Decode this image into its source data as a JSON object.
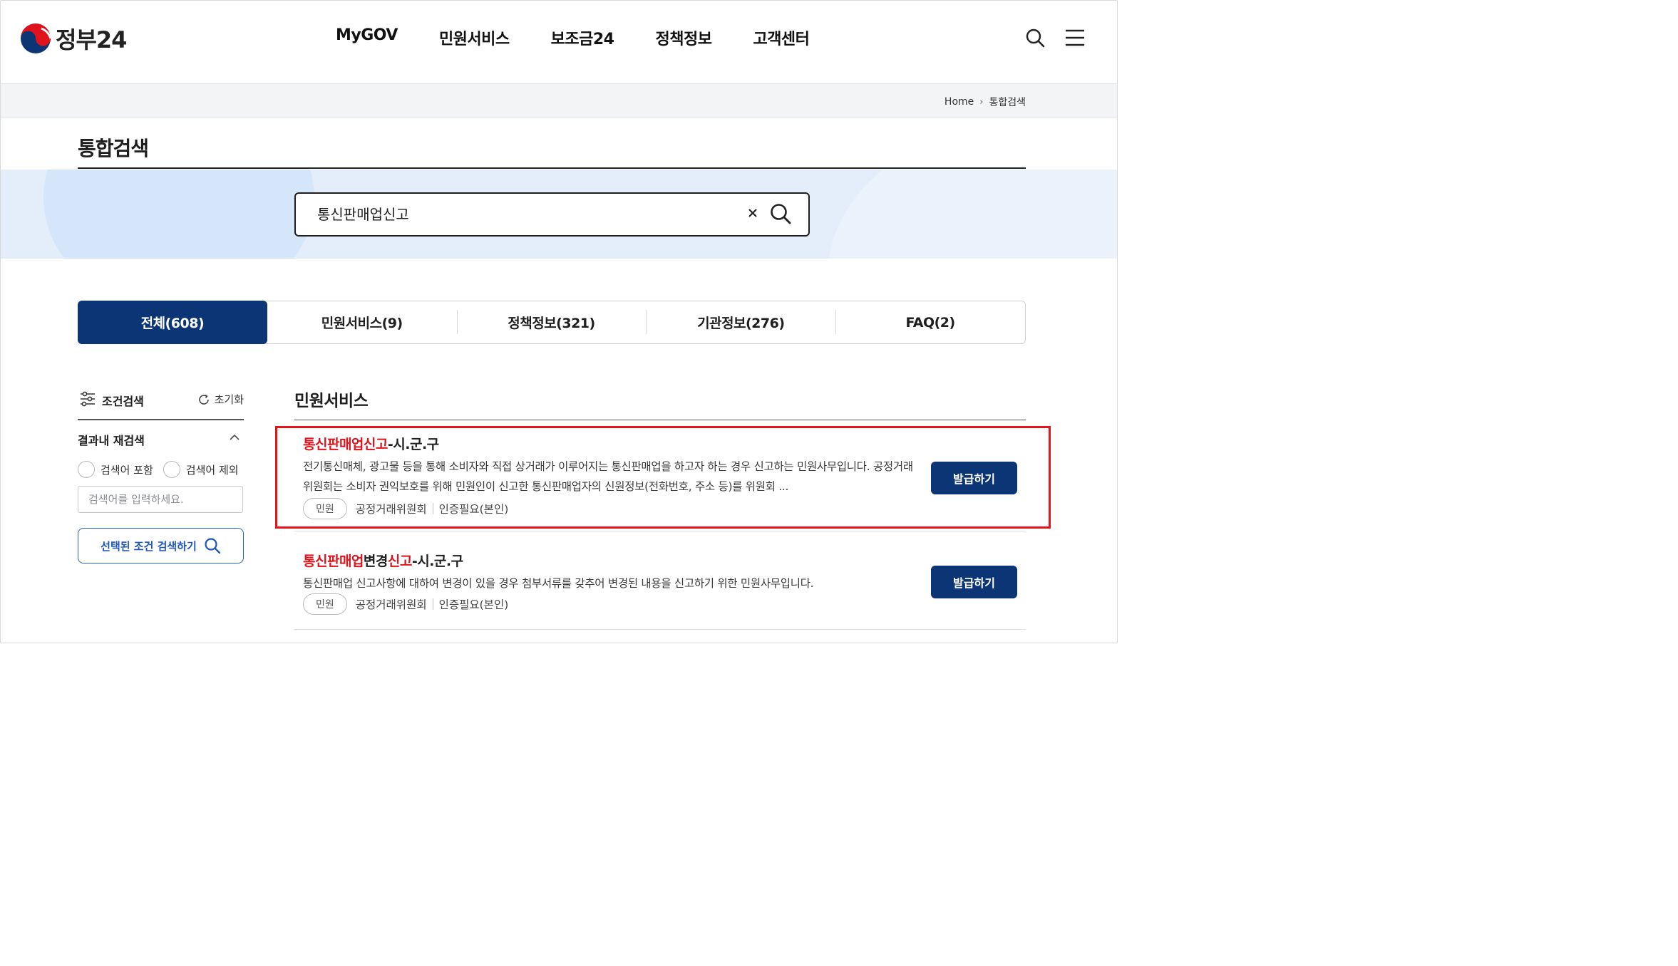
{
  "header": {
    "logo_text": "정부24",
    "nav": [
      "MyGOV",
      "민원서비스",
      "보조금24",
      "정책정보",
      "고객센터"
    ],
    "icons": [
      "search-icon",
      "hamburger-menu-icon"
    ]
  },
  "breadcrumb": {
    "home": "Home",
    "current": "통합검색"
  },
  "page": {
    "title": "통합검색"
  },
  "search": {
    "query": "통신판매업신고"
  },
  "tabs": [
    {
      "label": "전체(608)",
      "active": true
    },
    {
      "label": "민원서비스(9)",
      "active": false
    },
    {
      "label": "정책정보(321)",
      "active": false
    },
    {
      "label": "기관정보(276)",
      "active": false
    },
    {
      "label": "FAQ(2)",
      "active": false
    }
  ],
  "sidebar": {
    "condition_label": "조건검색",
    "reset_label": "초기화",
    "refine_title": "결과내 재검색",
    "include_label": "검색어 포함",
    "exclude_label": "검색어 제외",
    "keyword_placeholder": "검색어를 입력하세요.",
    "search_button": "선택된 조건 검색하기"
  },
  "results": {
    "section_title": "민원서비스",
    "items": [
      {
        "title_highlight_1": "통신판매업신고",
        "title_rest": "-시.군.구",
        "description": "전기통신매체, 광고물 등을 통해 소비자와 직접 상거래가 이루어지는 통신판매업을 하고자 하는 경우 신고하는 민원사무입니다. 공정거래위원회는 소비자 권익보호를 위해 민원인이 신고한 통신판매업자의 신원정보(전화번호, 주소 등)를 위원회 ...",
        "tag": "민원",
        "agency": "공정거래위원회",
        "auth": "인증필요(본인)",
        "button": "발급하기"
      },
      {
        "title_highlight_1": "통신판매업",
        "title_mid": "변경",
        "title_highlight_2": "신고",
        "title_rest": "-시.군.구",
        "description": "통신판매업 신고사항에 대하여 변경이 있을 경우 첨부서류를 갖추어 변경된 내용을 신고하기 위한 민원사무입니다.",
        "tag": "민원",
        "agency": "공정거래위원회",
        "auth": "인증필요(본인)",
        "button": "발급하기"
      }
    ]
  },
  "colors": {
    "primary": "#0c3576",
    "highlight": "#e0121b",
    "band": "#e4eefb"
  }
}
